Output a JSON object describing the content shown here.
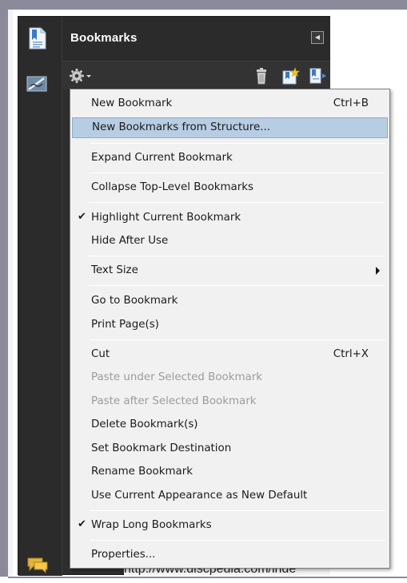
{
  "panel": {
    "title": "Bookmarks"
  },
  "behind": {
    "url_text": "http://www.discpedia.com/inde"
  },
  "menu": {
    "items": [
      {
        "label": "New Bookmark",
        "shortcut": "Ctrl+B",
        "state": "enabled"
      },
      {
        "label": "New Bookmarks from Structure...",
        "shortcut": "",
        "state": "highlighted"
      },
      {
        "label": "Expand Current Bookmark",
        "shortcut": "",
        "state": "enabled"
      },
      {
        "label": "Collapse Top-Level Bookmarks",
        "shortcut": "",
        "state": "enabled"
      },
      {
        "label": "Highlight Current Bookmark",
        "shortcut": "",
        "state": "checked"
      },
      {
        "label": "Hide After Use",
        "shortcut": "",
        "state": "enabled"
      },
      {
        "label": "Text Size",
        "shortcut": "",
        "state": "submenu"
      },
      {
        "label": "Go to Bookmark",
        "shortcut": "",
        "state": "enabled"
      },
      {
        "label": "Print Page(s)",
        "shortcut": "",
        "state": "enabled"
      },
      {
        "label": "Cut",
        "shortcut": "Ctrl+X",
        "state": "enabled"
      },
      {
        "label": "Paste under Selected Bookmark",
        "shortcut": "",
        "state": "disabled"
      },
      {
        "label": "Paste after Selected Bookmark",
        "shortcut": "",
        "state": "disabled"
      },
      {
        "label": "Delete Bookmark(s)",
        "shortcut": "",
        "state": "enabled"
      },
      {
        "label": "Set Bookmark Destination",
        "shortcut": "",
        "state": "enabled"
      },
      {
        "label": "Rename Bookmark",
        "shortcut": "",
        "state": "enabled"
      },
      {
        "label": "Use Current Appearance as New Default",
        "shortcut": "",
        "state": "enabled"
      },
      {
        "label": "Wrap Long Bookmarks",
        "shortcut": "",
        "state": "checked"
      },
      {
        "label": "Properties...",
        "shortcut": "",
        "state": "enabled"
      }
    ],
    "checkmark": "✔"
  },
  "icons": {
    "bookmarks_panel": "bookmark-document-icon",
    "signatures": "signature-pen-icon",
    "comments": "comment-bubbles-icon",
    "options": "gear-icon",
    "delete": "trash-icon",
    "new_bookmark": "new-bookmark-icon",
    "expand": "expand-bookmark-icon",
    "collapse_panel": "collapse-panel-icon"
  },
  "colors": {
    "highlight": "#b7cde4",
    "menu_bg": "#f1f1f1",
    "panel_bg": "#2e2e2e",
    "disabled_text": "#9b9b9b"
  }
}
